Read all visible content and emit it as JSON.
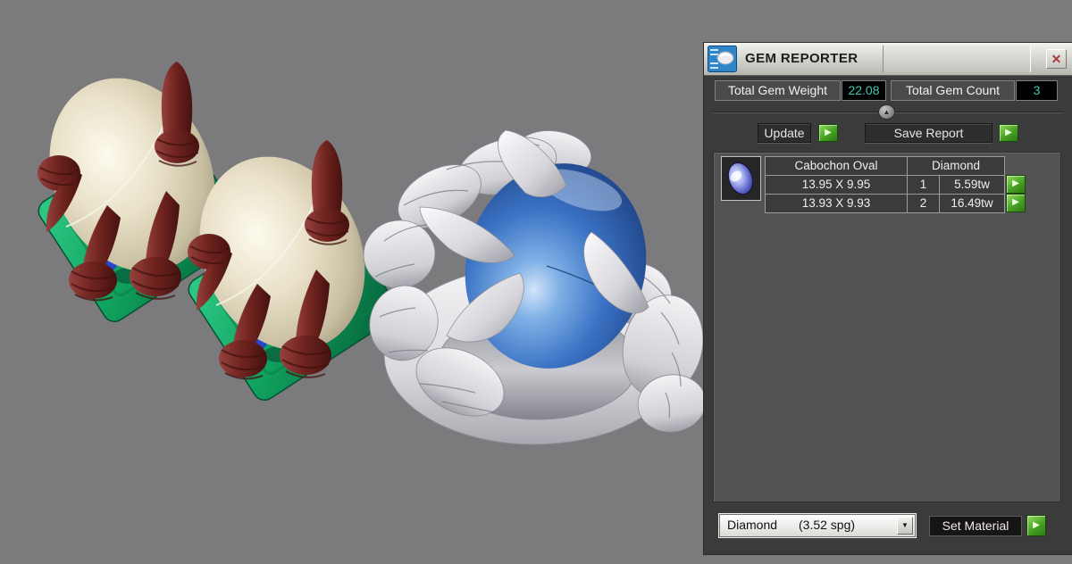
{
  "window": {
    "title": "GEM REPORTER"
  },
  "icons": {
    "close": "✕",
    "run": "▶",
    "dropdown": "▼",
    "slider": "▲"
  },
  "totals": {
    "weight_label": "Total Gem Weight",
    "weight_value": "22.08",
    "count_label": "Total Gem Count",
    "count_value": "3"
  },
  "actions": {
    "update_label": "Update",
    "save_report_label": "Save Report",
    "set_material_label": "Set Material"
  },
  "gem_table": {
    "shape_header": "Cabochon Oval",
    "material_header": "Diamond",
    "rows": [
      {
        "size": "13.95 X 9.95",
        "count": "1",
        "weight": "5.59tw"
      },
      {
        "size": "13.93 X 9.93",
        "count": "2",
        "weight": "16.49tw"
      }
    ]
  },
  "material_combo": {
    "value": "Diamond",
    "density": "(3.52 spg)"
  },
  "colors": {
    "accent_teal": "#3EC9B2",
    "button_green": "#48A124",
    "viewport_gray": "#7B7B7D",
    "panel_gray": "#3B3B3B",
    "gem_blue": "#3A72C4",
    "claw_maroon": "#71241F",
    "base_green": "#0F9E5C",
    "gem_cream": "#E9E1C8"
  }
}
